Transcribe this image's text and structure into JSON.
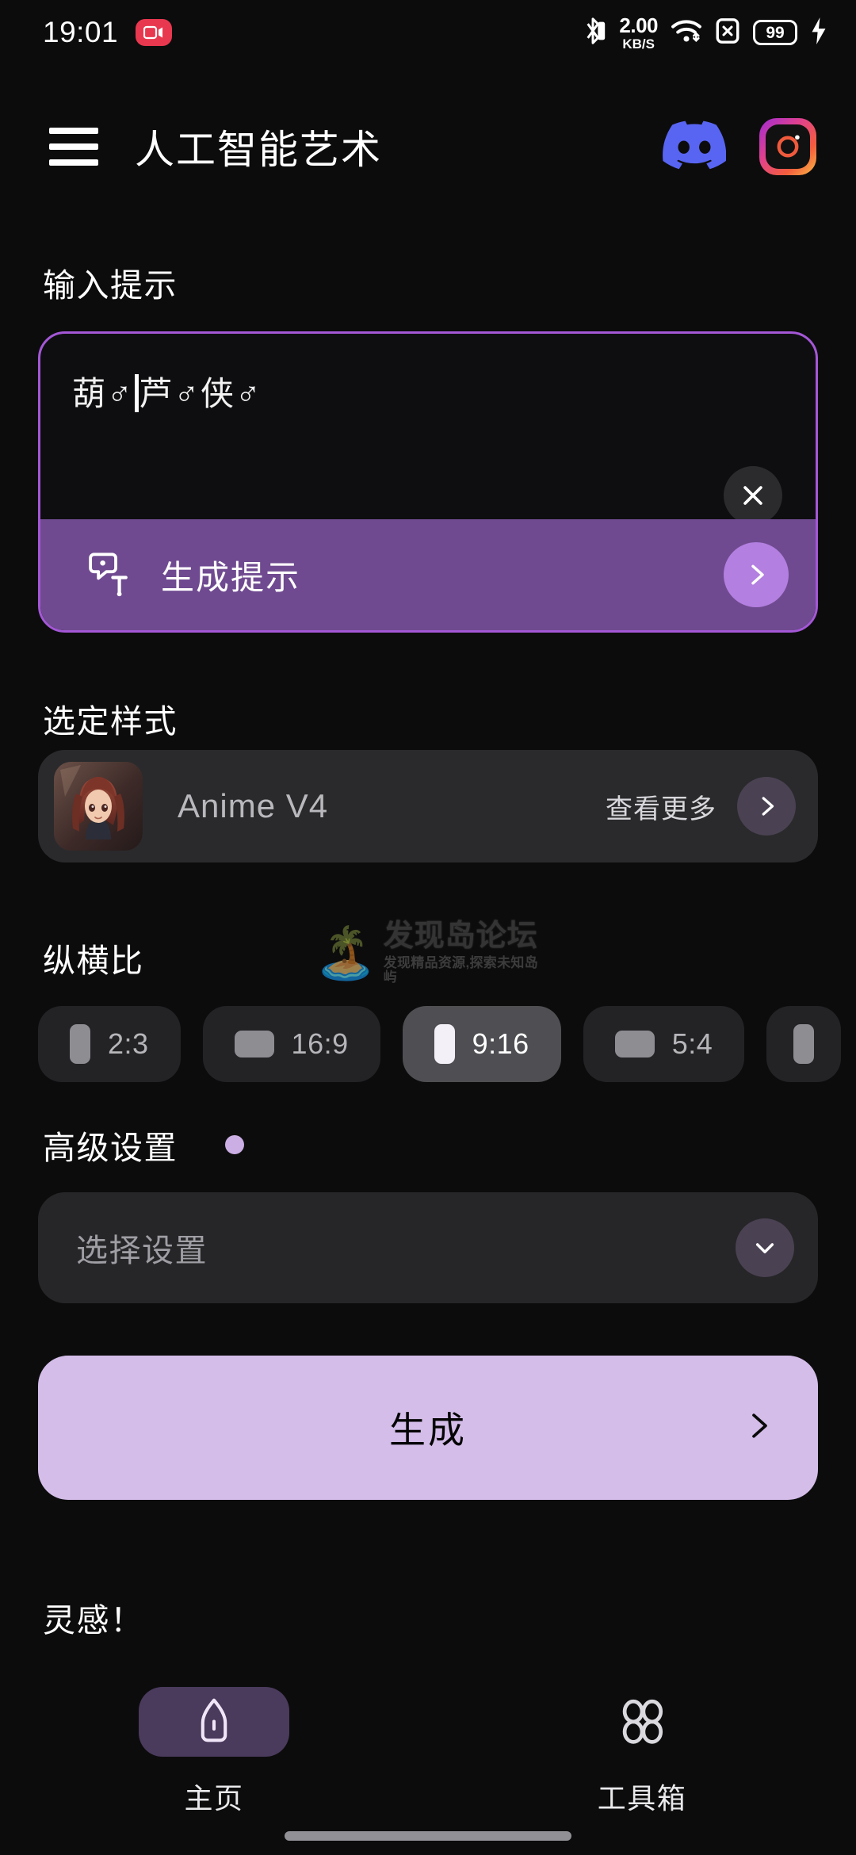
{
  "status_bar": {
    "time": "19:01",
    "recording_icon": "screen-record-icon",
    "bluetooth_icon": "bluetooth-icon",
    "net_speed_value": "2.00",
    "net_speed_unit": "KB/S",
    "wifi_icon": "wifi-icon",
    "sim_icon": "sim-no-service-icon",
    "battery_level": "99",
    "charging_icon": "charging-bolt-icon"
  },
  "app_bar": {
    "menu_icon": "hamburger-menu-icon",
    "title": "人工智能艺术",
    "discord_icon": "discord-icon",
    "instagram_icon": "instagram-icon"
  },
  "prompt_section": {
    "label": "输入提示",
    "value": "葫♂芦♂侠♂",
    "value_before_caret": "葫♂",
    "value_after_caret": "芦♂侠♂",
    "clear_icon": "close-icon",
    "generate_prompt_label": "生成提示",
    "generate_prompt_icon": "magic-text-icon",
    "generate_prompt_arrow_icon": "chevron-right-icon"
  },
  "style_section": {
    "label": "选定样式",
    "style_name": "Anime V4",
    "thumbnail": "anime-style-thumbnail",
    "view_more_label": "查看更多",
    "view_more_icon": "chevron-right-icon"
  },
  "aspect_section": {
    "label": "纵横比",
    "selected": "9:16",
    "options": [
      {
        "label": "2:3",
        "orientation": "portrait",
        "selected": false
      },
      {
        "label": "16:9",
        "orientation": "landscape",
        "selected": false
      },
      {
        "label": "9:16",
        "orientation": "portrait",
        "selected": true
      },
      {
        "label": "5:4",
        "orientation": "landscape",
        "selected": false
      },
      {
        "label": "",
        "orientation": "portrait",
        "selected": false
      }
    ]
  },
  "advanced_section": {
    "label": "高级设置",
    "badge_color": "#cbaee4",
    "select_placeholder": "选择设置",
    "chevron_icon": "chevron-down-icon"
  },
  "generate": {
    "label": "生成",
    "arrow_icon": "chevron-right-icon",
    "accent_color": "#d4bde9"
  },
  "inspiration": {
    "label": "灵感！"
  },
  "watermark": {
    "emoji": "🏝️",
    "title": "发现岛论坛",
    "subtitle": "发现精品资源,探索未知岛屿"
  },
  "bottom_nav": {
    "items": [
      {
        "label": "主页",
        "icon": "home-icon",
        "active": true
      },
      {
        "label": "工具箱",
        "icon": "toolbox-grid-icon",
        "active": false
      }
    ]
  },
  "theme": {
    "background": "#0c0c0d",
    "accent_purple": "#a457d6",
    "accent_light": "#d4bde9"
  }
}
